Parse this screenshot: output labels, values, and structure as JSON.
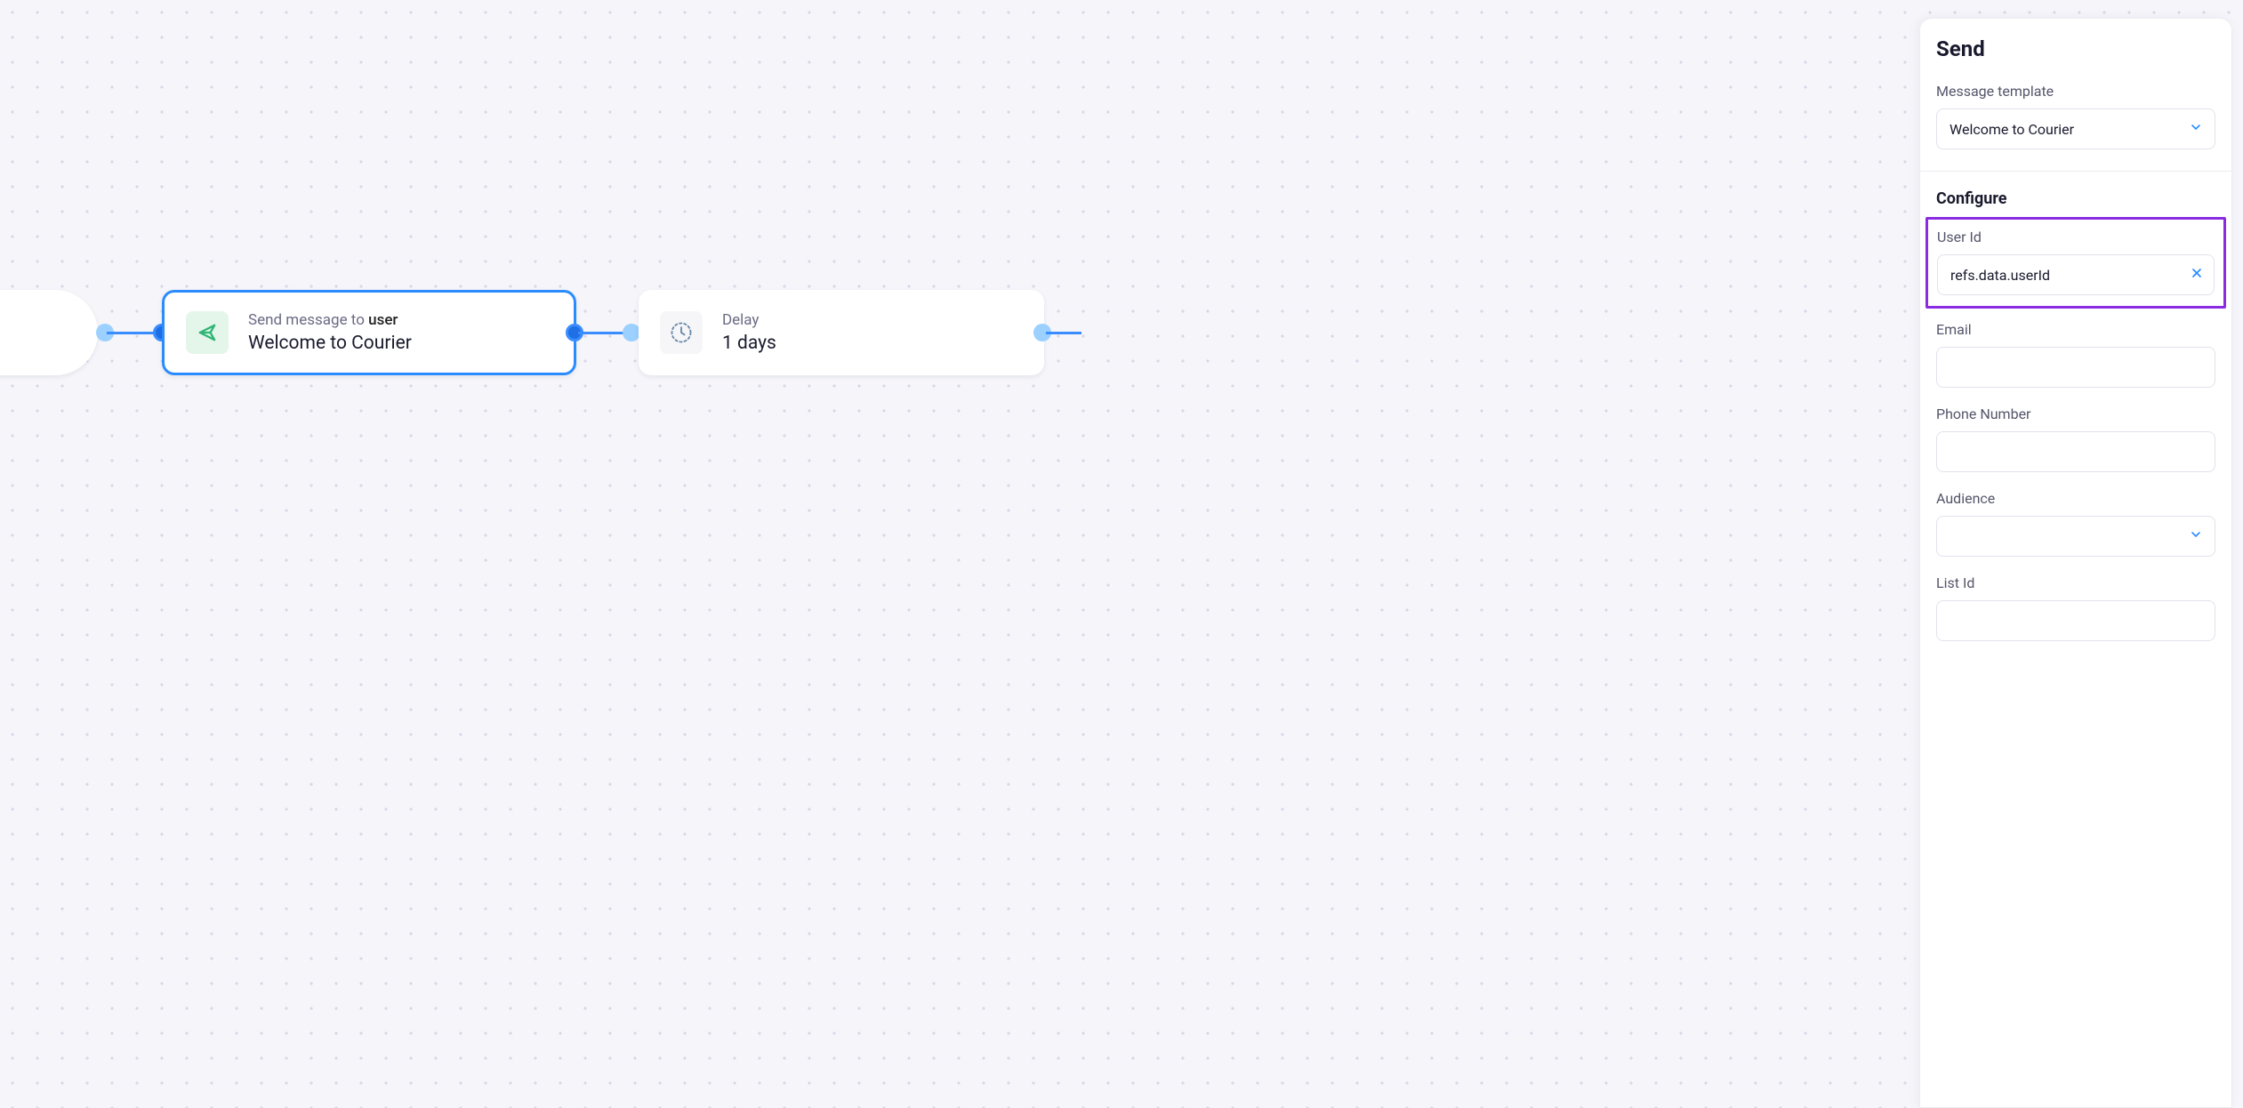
{
  "canvas": {
    "send_node": {
      "label_prefix": "Send message to ",
      "label_target": "user",
      "template_name": "Welcome to Courier"
    },
    "delay_node": {
      "label": "Delay",
      "value": "1 days"
    }
  },
  "panel": {
    "title": "Send",
    "message_template": {
      "label": "Message template",
      "value": "Welcome to Courier"
    },
    "configure": {
      "title": "Configure",
      "user_id": {
        "label": "User Id",
        "value": "refs.data.userId"
      },
      "email": {
        "label": "Email",
        "value": ""
      },
      "phone": {
        "label": "Phone Number",
        "value": ""
      },
      "audience": {
        "label": "Audience",
        "value": ""
      },
      "list_id": {
        "label": "List Id",
        "value": ""
      }
    }
  }
}
